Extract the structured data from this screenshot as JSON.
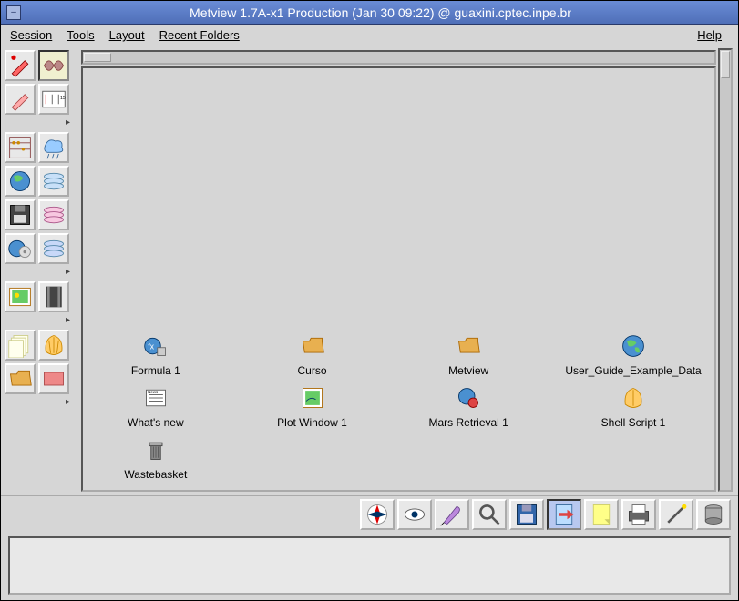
{
  "window": {
    "title": "Metview 1.7A-x1 Production (Jan 30 09:22) @ guaxini.cptec.inpe.br"
  },
  "menu": {
    "session": "Session",
    "tools": "Tools",
    "layout": "Layout",
    "recent_folders": "Recent Folders",
    "help": "Help"
  },
  "sidebar": {
    "groups": [
      {
        "cells": [
          "pen-red-icon",
          "fly-icon",
          "pen-pink-icon",
          "gauge-icon"
        ]
      },
      {
        "cells": [
          "abacus-icon",
          "rain-icon",
          "globe-icon",
          "disc-stack-icon",
          "floppy-dark-icon",
          "disc-pink-icon",
          "globe-cd-icon",
          "disc-blue-icon"
        ]
      },
      {
        "cells": [
          "picture-icon",
          "film-icon"
        ]
      },
      {
        "cells": [
          "stack-paper-icon",
          "shell-icon",
          "folder-open-icon",
          "card-red-icon"
        ]
      }
    ]
  },
  "icons": {
    "col1": [
      {
        "name": "formula-1",
        "label": "Formula 1",
        "glyph": "formula-icon"
      },
      {
        "name": "whats-new",
        "label": "What's new",
        "glyph": "news-icon"
      },
      {
        "name": "wastebasket",
        "label": "Wastebasket",
        "glyph": "trash-icon"
      }
    ],
    "col2": [
      {
        "name": "curso",
        "label": "Curso",
        "glyph": "folder-icon"
      },
      {
        "name": "plot-window-1",
        "label": "Plot Window 1",
        "glyph": "plot-window-icon"
      }
    ],
    "col3": [
      {
        "name": "metview",
        "label": "Metview",
        "glyph": "folder-icon"
      },
      {
        "name": "mars-retrieval-1",
        "label": "Mars Retrieval 1",
        "glyph": "mars-icon"
      }
    ],
    "col4": [
      {
        "name": "user-guide-example-data",
        "label": "User_Guide_Example_Data",
        "glyph": "earth-icon"
      },
      {
        "name": "shell-script-1",
        "label": "Shell Script 1",
        "glyph": "shell-script-icon"
      }
    ]
  },
  "toolbar": {
    "buttons": [
      {
        "name": "compass-tool",
        "glyph": "compass-icon",
        "selected": false
      },
      {
        "name": "eye-tool",
        "glyph": "eye-icon",
        "selected": false
      },
      {
        "name": "pen-feather-tool",
        "glyph": "feather-pen-icon",
        "selected": false
      },
      {
        "name": "magnifier-tool",
        "glyph": "magnifier-icon",
        "selected": false
      },
      {
        "name": "floppy-tool",
        "glyph": "floppy-icon",
        "selected": false
      },
      {
        "name": "page-blank-tool",
        "glyph": "page-arrow-icon",
        "selected": true
      },
      {
        "name": "note-tool",
        "glyph": "note-icon",
        "selected": false
      },
      {
        "name": "printer-tool",
        "glyph": "printer-icon",
        "selected": false
      },
      {
        "name": "wand-tool",
        "glyph": "wand-icon",
        "selected": false
      },
      {
        "name": "cylinder-tool",
        "glyph": "cylinder-icon",
        "selected": false
      }
    ]
  }
}
